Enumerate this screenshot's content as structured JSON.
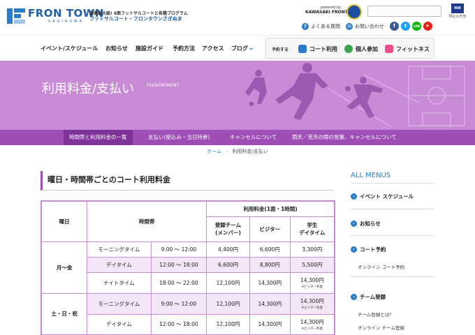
{
  "header": {
    "logo_main": "FRON TOWN",
    "logo_sub": "SAGINUMA",
    "tagline_1": "関東最大級! 6面フットサルコートと各種プログラム",
    "tagline_2": "フットサルコート・フロンタウンさぎぬま",
    "powered_by": "powered by",
    "powered_brand": "KAWASAKI FRONTALE",
    "weather_badge": "NW",
    "weather_text": "現在の天気",
    "links": {
      "faq": "よくある質問",
      "contact": "お問い合わせ"
    },
    "social": {
      "facebook": "f",
      "twitter": "t",
      "line": "LINE",
      "youtube": "▶"
    }
  },
  "nav": {
    "items": [
      "イベント/スケジュール",
      "お知らせ",
      "施設ガイド",
      "予約方法",
      "アクセス",
      "ブログ"
    ],
    "reserve_label": "予約する",
    "reserve_buttons": [
      "コート利用",
      "個人参加",
      "フィットネス"
    ]
  },
  "hero": {
    "title": "利用料金/支払い",
    "subtitle": "FEE&PAYMENT"
  },
  "subnav": {
    "items": [
      "時間帯と利用料金の一覧",
      "支払い(振込み・当日持参)",
      "キャンセルについて",
      "雨天／荒天の際の営業、キャンセルについて"
    ]
  },
  "breadcrumb": {
    "home": "ホーム",
    "separator": "›",
    "current": "利用料金/支払い"
  },
  "section": {
    "title": "曜日・時間帯ごとのコート利用料金"
  },
  "table": {
    "headers": {
      "day": "曜日",
      "timeslot": "時間帯",
      "fee_group": "利用料金(1面・1時間)",
      "member": "登録チーム\n(メンバー)",
      "visitor": "ビジター",
      "student": "学生\nデイタイム"
    },
    "groups": [
      {
        "day": "月〜金",
        "rows": [
          {
            "name": "モーニングタイム",
            "time": "9:00 〜 12:00",
            "member": "4,400円",
            "visitor": "6,600円",
            "student": "3,300円",
            "note": ""
          },
          {
            "name": "デイタイム",
            "time": "12:00 〜 18:00",
            "member": "6,600円",
            "visitor": "8,800円",
            "student": "5,500円",
            "note": ""
          },
          {
            "name": "ナイトタイム",
            "time": "18:00 〜 22:00",
            "member": "12,100円",
            "visitor": "14,300円",
            "student": "14,300円",
            "note": "※ビジター料金"
          }
        ]
      },
      {
        "day": "土・日・祝",
        "rows": [
          {
            "name": "モーニングタイム",
            "time": "9:00 〜 12:00",
            "member": "12,100円",
            "visitor": "14,300円",
            "student": "14,300円",
            "note": "※ビジター料金"
          },
          {
            "name": "デイタイム",
            "time": "12:00 〜 18:00",
            "member": "12,100円",
            "visitor": "14,300円",
            "student": "14,300円",
            "note": "※ビジター料金"
          }
        ]
      }
    ]
  },
  "sidebar": {
    "heading": "ALL MENUS",
    "items": [
      "イベント スケジュール",
      "お知らせ",
      "コート予約",
      "チーム登録"
    ],
    "sub_court": "オンライン コート予約",
    "sub_team_1": "チーム登録とは？",
    "sub_team_2": "オンライン チーム登録"
  }
}
